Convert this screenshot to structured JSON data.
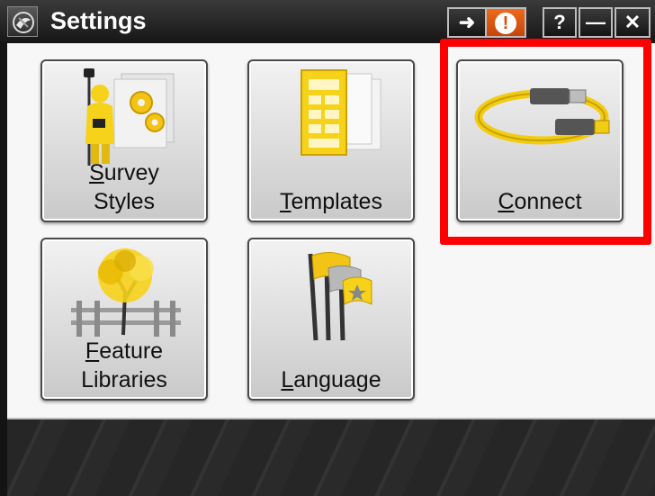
{
  "window": {
    "title": "Settings"
  },
  "titlebar": {
    "buttons": [
      {
        "name": "login",
        "glyph": "➜"
      },
      {
        "name": "alert",
        "glyph": "!"
      },
      {
        "name": "help",
        "glyph": "?"
      },
      {
        "name": "minimize",
        "glyph": "—"
      },
      {
        "name": "close",
        "glyph": "✕"
      }
    ]
  },
  "tiles": [
    {
      "id": "survey-styles",
      "label_hot": "S",
      "label_rest": "urvey",
      "label_line2": "Styles",
      "icon": "surveyor-gears-icon"
    },
    {
      "id": "templates",
      "label_hot": "T",
      "label_rest": "emplates",
      "icon": "document-templates-icon"
    },
    {
      "id": "connect",
      "label_hot": "C",
      "label_rest": "onnect",
      "icon": "usb-cable-icon"
    },
    {
      "id": "feature-libraries",
      "label_hot": "F",
      "label_rest": "eature",
      "label_line2": "Libraries",
      "icon": "tree-fence-icon"
    },
    {
      "id": "language",
      "label_hot": "L",
      "label_rest": "anguage",
      "icon": "flags-icon"
    }
  ],
  "highlight": {
    "target": "connect",
    "color": "#ff0000"
  },
  "colors": {
    "alert": "#e85a12",
    "accent_yellow": "#f6d21a"
  }
}
